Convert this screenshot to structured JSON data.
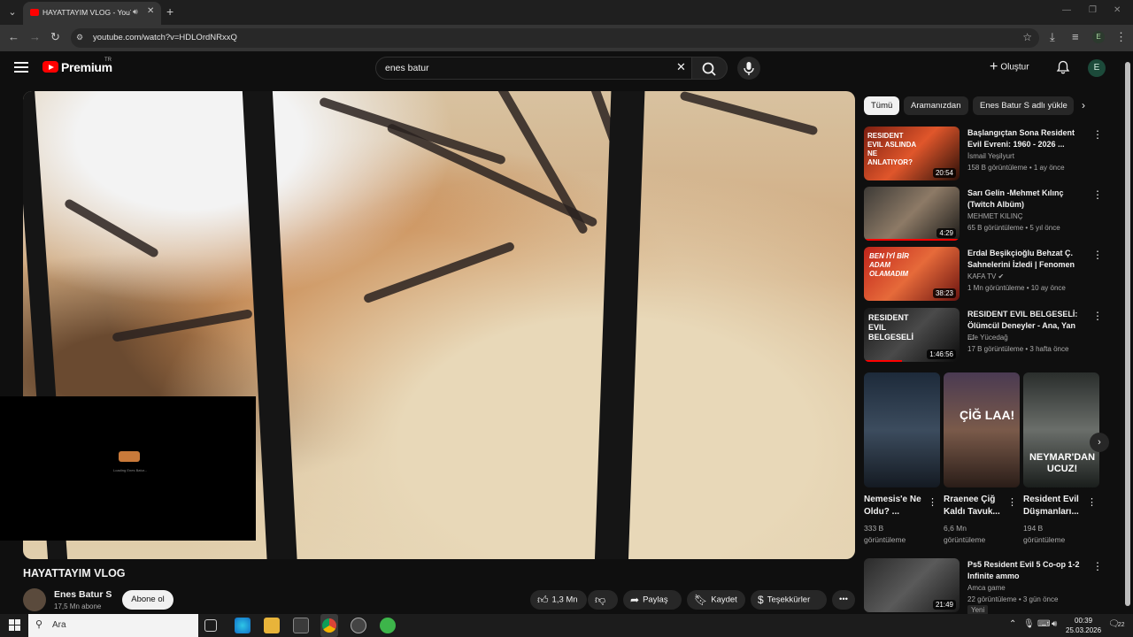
{
  "browser": {
    "tab_title": "HAYATTAYIM VLOG - YouTu",
    "url": "youtube.com/watch?v=HDLOrdNRxxQ",
    "profile_initial": "E"
  },
  "youtube": {
    "brand": "Premium",
    "region": "TR",
    "search_value": "enes batur",
    "create_label": "Oluştur",
    "avatar_initial": "E"
  },
  "video": {
    "title": "HAYATTAYIM VLOG",
    "channel_name": "Enes Batur S",
    "subscribers": "17,5 Mn abone",
    "subscribe_label": "Abone ol",
    "like_count": "1,3 Mn",
    "share_label": "Paylaş",
    "save_label": "Kaydet",
    "thanks_label": "Teşekkürler",
    "miniplayer_caption": "Loading Enes Batur..."
  },
  "sidebar": {
    "chips": [
      "Tümü",
      "Aramanızdan",
      "Enes Batur S adlı yükle"
    ],
    "recommendations": [
      {
        "title": "Başlangıçtan Sona Resident Evil Evreni: 1960 - 2026 ...",
        "channel": "İsmail Yeşilyurt",
        "meta": "158 B görüntüleme • 1 ay önce",
        "duration": "20:54",
        "thumb_text": "RESIDENT EVIL ASLINDA NE ANLATIYOR?"
      },
      {
        "title": "Sarı Gelin -Mehmet Kılınç (Twitch Albüm)",
        "channel": "MEHMET KILINÇ",
        "meta": "65 B görüntüleme • 5 yıl önce",
        "duration": "4:29",
        "thumb_text": ""
      },
      {
        "title": "Erdal Beşikçioğlu Behzat Ç. Sahnelerini İzledi | Fenomen",
        "channel": "KAFA TV",
        "meta": "1 Mn görüntüleme • 10 ay önce",
        "duration": "38:23",
        "thumb_text": "BEN İYİ BİR ADAM OLAMADIM"
      },
      {
        "title": "RESIDENT EVIL BELGESELİ: Ölümcül Deneyler - Ana, Yan ...",
        "channel": "Efe Yücedağ",
        "meta": "17 B görüntüleme • 3 hafta önce",
        "duration": "1:46:56",
        "thumb_text": "RESIDENT EVIL BELGESELİ"
      },
      {
        "title": "Ps5 Resident Evil 5 Co-op 1-2 Infinite ammo",
        "channel": "Amca game",
        "meta": "22 görüntüleme • 3 gün önce",
        "duration": "21:49",
        "badge": "Yeni"
      }
    ],
    "shorts": [
      {
        "title": "Nemesis'e Ne Oldu? ...",
        "views": "333 B görüntüleme",
        "thumb_text": ""
      },
      {
        "title": "Rraenee Çiğ Kaldı Tavuk...",
        "views": "6,6 Mn görüntüleme",
        "thumb_text": "ÇİĞ LAA!"
      },
      {
        "title": "Resident Evil Düşmanları...",
        "views": "194 B görüntüleme",
        "thumb_text": "NEYMAR'DAN UCUZ!"
      }
    ]
  },
  "taskbar": {
    "search_placeholder": "Ara",
    "time": "00:39",
    "date": "25.03.2026",
    "notifications": "22"
  }
}
